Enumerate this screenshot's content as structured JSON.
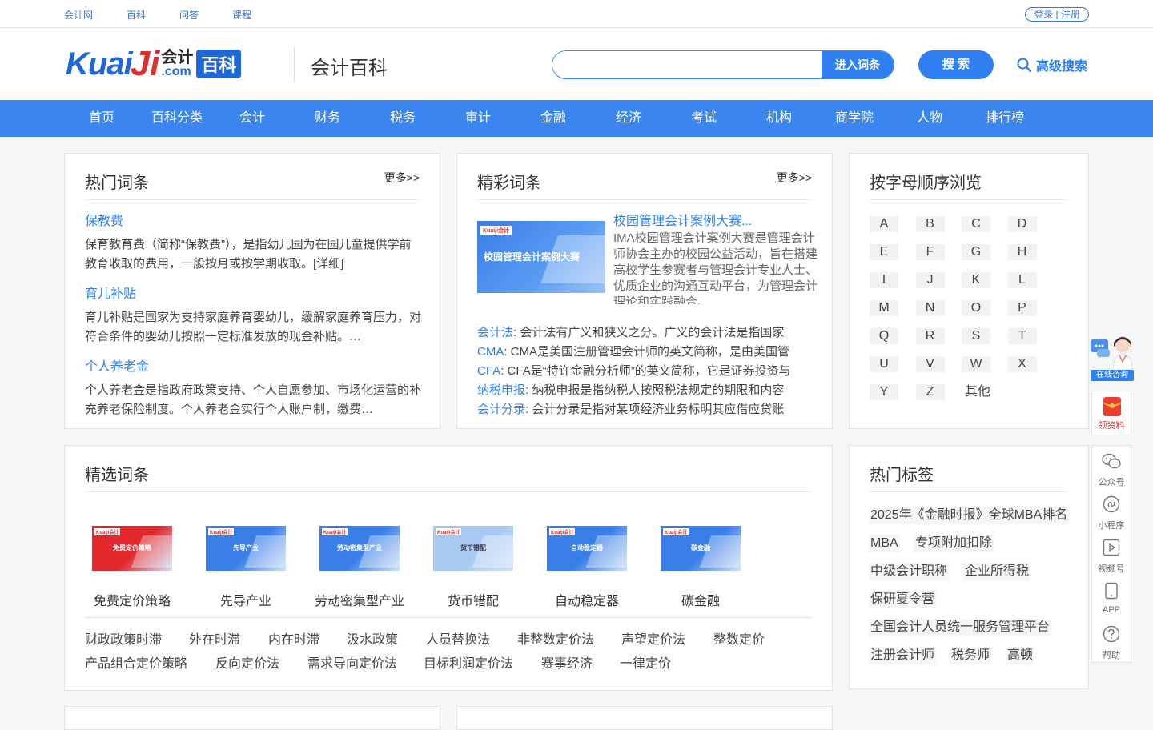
{
  "topbar": {
    "links": [
      "会计网",
      "百科",
      "问答",
      "课程"
    ],
    "login": "登录 | 注册"
  },
  "header": {
    "logo": {
      "kuai": "Kuai",
      "ji": "Ji",
      "kuaiji": "会计",
      "com": ".com",
      "baike": "百科"
    },
    "site_name": "会计百科",
    "search": {
      "placeholder": "",
      "enter_label": "进入词条",
      "search_label": "搜 索",
      "advanced_label": "高级搜索"
    }
  },
  "nav": [
    "首页",
    "百科分类",
    "会计",
    "财务",
    "税务",
    "审计",
    "金融",
    "经济",
    "考试",
    "机构",
    "商学院",
    "人物",
    "排行榜"
  ],
  "hot_entries": {
    "title": "热门词条",
    "more": "更多>>",
    "items": [
      {
        "name": "保教费",
        "desc": "保育教育费（简称“保教费”），是指幼儿园为在园儿童提供学前教育收取的费用，一般按月或按学期收取。[详细]"
      },
      {
        "name": "育儿补贴",
        "desc": "育儿补贴是国家为支持家庭养育婴幼儿，缓解家庭养育压力，对符合条件的婴幼儿按照一定标准发放的现金补贴。…"
      },
      {
        "name": "个人养老金",
        "desc": "个人养老金是指政府政策支持、个人自愿参加、市场化运营的补充养老保险制度。个人养老金实行个人账户制，缴费…"
      }
    ]
  },
  "featured_entries": {
    "title": "精彩词条",
    "more": "更多>>",
    "image_text": "校园管理会计案例大赛",
    "image_logo": "Kuaiji会计",
    "headline": "校园管理会计案例大赛...",
    "desc": "IMA校园管理会计案例大赛是管理会计师协会主办的校园公益活动，旨在搭建高校学生参赛者与管理会计专业人士、优质企业的沟通互动平台，为管理会计理论和实践融合、",
    "list": [
      {
        "term": "会计法",
        "desc": ": 会计法有广义和狭义之分。广义的会计法是指国家"
      },
      {
        "term": "CMA",
        "desc": ": CMA是美国注册管理会计师的英文简称，是由美国管"
      },
      {
        "term": "CFA",
        "desc": ": CFA是“特许金融分析师”的英文简称，它是证券投资与"
      },
      {
        "term": "纳税申报",
        "desc": ": 纳税申报是指纳税人按照税法规定的期限和内容"
      },
      {
        "term": "会计分录",
        "desc": ": 会计分录是指对某项经济业务标明其应借应贷账"
      }
    ]
  },
  "alphabet": {
    "title": "按字母顺序浏览",
    "letters": [
      "A",
      "B",
      "C",
      "D",
      "E",
      "F",
      "G",
      "H",
      "I",
      "J",
      "K",
      "L",
      "M",
      "N",
      "O",
      "P",
      "Q",
      "R",
      "S",
      "T",
      "U",
      "V",
      "W",
      "X",
      "Y",
      "Z",
      "其他"
    ]
  },
  "selected_entries": {
    "title": "精选词条",
    "pictures": [
      {
        "caption": "免费定价策略",
        "img_text": "免费定价策略",
        "color": "#e0282d"
      },
      {
        "caption": "先导产业",
        "img_text": "先导产业",
        "color": "#3a7ee8"
      },
      {
        "caption": "劳动密集型产业",
        "img_text": "劳动密集型产业",
        "color": "#3a7ee8"
      },
      {
        "caption": "货币错配",
        "img_text": "货币错配",
        "color": "#a9c9f2"
      },
      {
        "caption": "自动稳定器",
        "img_text": "自动稳定器",
        "color": "#3a7ee8"
      },
      {
        "caption": "碳金融",
        "img_text": "碳金融",
        "color": "#3a7ee8"
      }
    ],
    "row1": [
      "财政政策时滞",
      "外在时滞",
      "内在时滞",
      "汲水政策",
      "人员替换法",
      "非整数定价法",
      "声望定价法",
      "整数定价"
    ],
    "row2": [
      "产品组合定价策略",
      "反向定价法",
      "需求导向定价法",
      "目标利润定价法",
      "赛事经济",
      "一律定价"
    ]
  },
  "hot_tags": {
    "title": "热门标签",
    "tags": [
      "2025年《金融时报》全球MBA排名",
      "MBA",
      "专项附加扣除",
      "中级会计职称",
      "企业所得税",
      "保研夏令营",
      "全国会计人员统一服务管理平台",
      "注册会计师",
      "税务师",
      "高顿"
    ]
  },
  "float": {
    "consult": "在线咨询",
    "gift": "领资料",
    "tools": [
      "公众号",
      "小程序",
      "视频号",
      "APP",
      "帮助"
    ]
  },
  "colors": {
    "brand_blue": "#3a86ee",
    "link_blue": "#2f7ff0",
    "logo_red": "#e02d2d"
  }
}
